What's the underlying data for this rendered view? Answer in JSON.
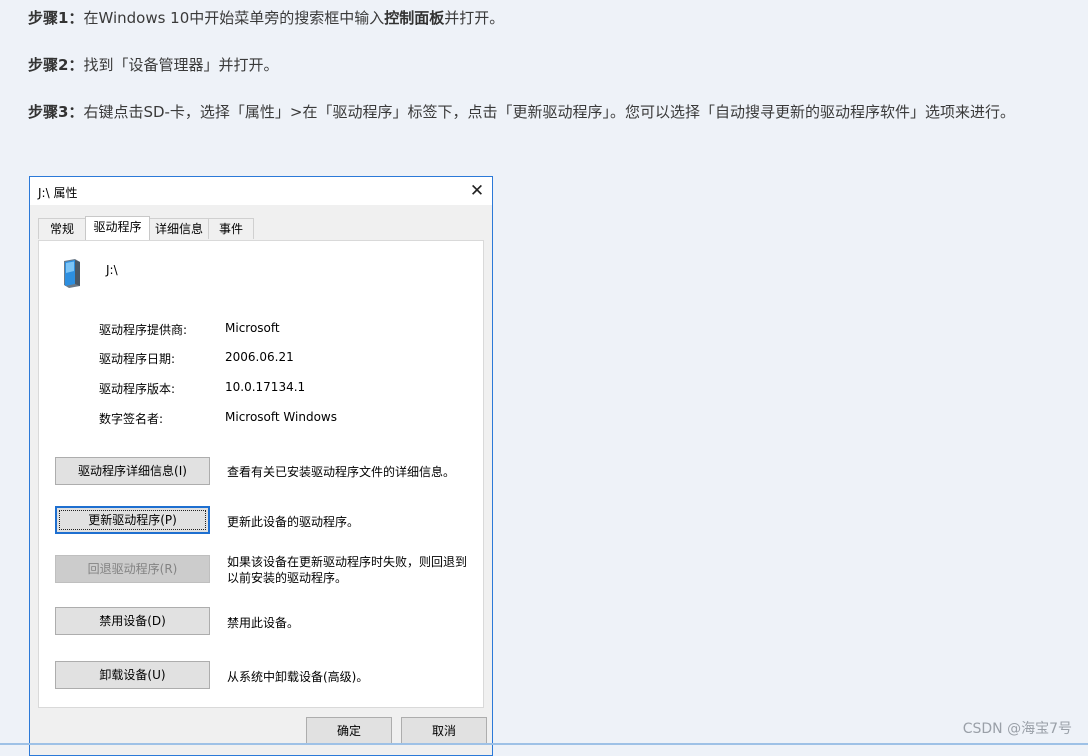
{
  "steps": [
    {
      "label": "步骤1：",
      "parts": [
        "在Windows 10中开始菜单旁的搜索框中输入",
        "控制面板",
        "并打开。"
      ]
    },
    {
      "label": "步骤2：",
      "text": "找到「设备管理器」并打开。"
    },
    {
      "label": "步骤3：",
      "text": "右键点击SD-卡，选择「属性」>在「驱动程序」标签下，点击「更新驱动程序」。您可以选择「自动搜寻更新的驱动程序软件」选项来进行。"
    }
  ],
  "dialog": {
    "title": "J:\\ 属性",
    "close_glyph": "✕",
    "tabs": [
      "常规",
      "驱动程序",
      "详细信息",
      "事件"
    ],
    "active_tab": "驱动程序",
    "device_name": "J:\\",
    "info": {
      "provider_label": "驱动程序提供商:",
      "provider": "Microsoft",
      "date_label": "驱动程序日期:",
      "date": "2006.06.21",
      "version_label": "驱动程序版本:",
      "version": "10.0.17134.1",
      "signer_label": "数字签名者:",
      "signer": "Microsoft Windows"
    },
    "actions": {
      "details_btn": "驱动程序详细信息(I)",
      "details_desc": "查看有关已安装驱动程序文件的详细信息。",
      "update_btn": "更新驱动程序(P)",
      "update_desc": "更新此设备的驱动程序。",
      "rollback_btn": "回退驱动程序(R)",
      "rollback_desc": "如果该设备在更新驱动程序时失败，则回退到以前安装的驱动程序。",
      "disable_btn": "禁用设备(D)",
      "disable_desc": "禁用此设备。",
      "uninstall_btn": "卸载设备(U)",
      "uninstall_desc": "从系统中卸载设备(高级)。"
    },
    "ok_label": "确定",
    "cancel_label": "取消"
  },
  "watermark": "CSDN @海宝7号",
  "colors": {
    "page_bg": "#eef2f8",
    "dialog_border": "#2b79d8",
    "focus_blue": "#1e6fd0"
  }
}
